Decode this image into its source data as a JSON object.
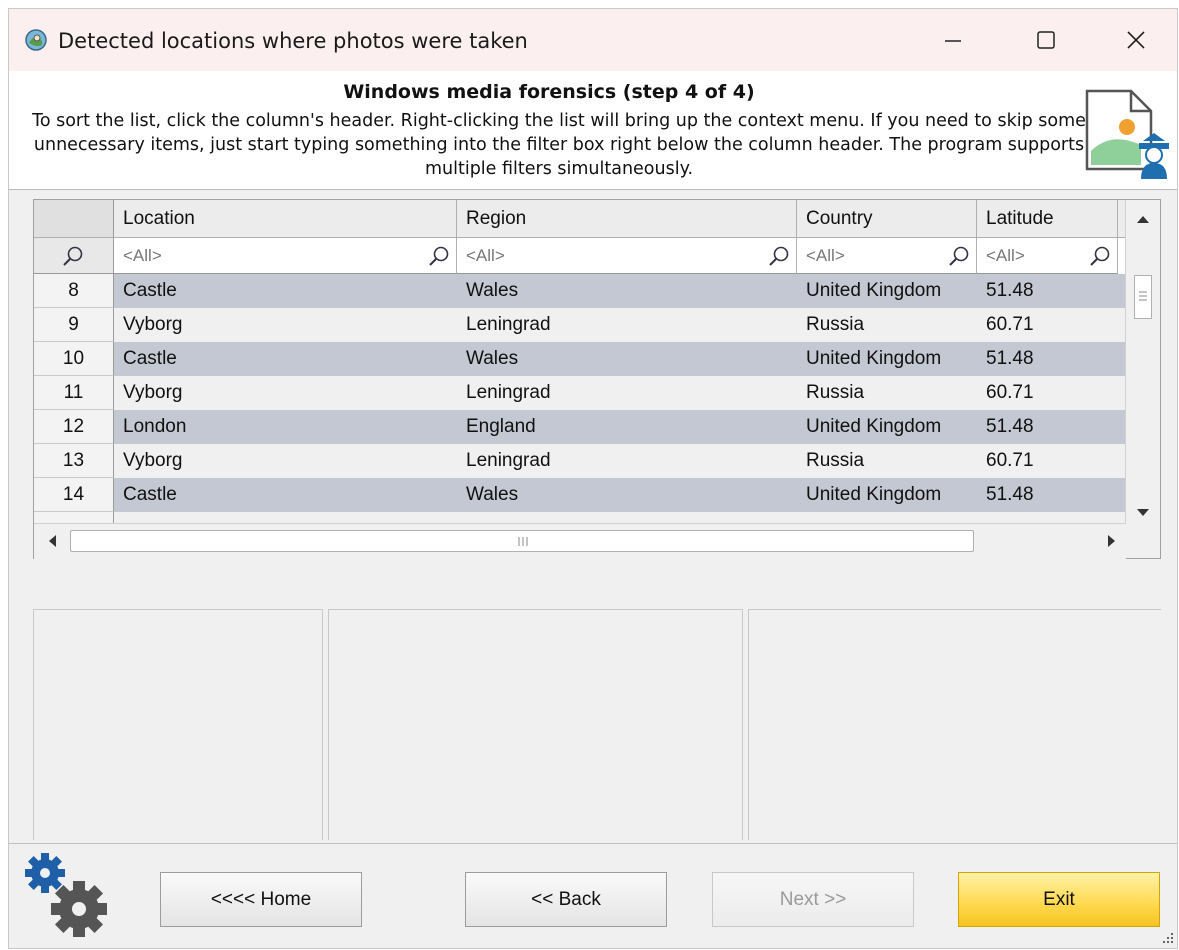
{
  "window": {
    "title": "Detected locations where photos were taken"
  },
  "header": {
    "title": "Windows media forensics (step 4 of 4)",
    "description": "To sort the list, click the column's header. Right-clicking the list will bring up the context menu. If you need to skip some unnecessary items, just start typing something into the filter box right below the column header. The program supports multiple filters simultaneously."
  },
  "grid": {
    "columns": [
      "Location",
      "Region",
      "Country",
      "Latitude"
    ],
    "filter_placeholder": "<All>",
    "rows": [
      {
        "num": "8",
        "location": "Castle",
        "region": "Wales",
        "country": "United Kingdom",
        "latitude": "51.48"
      },
      {
        "num": "9",
        "location": "Vyborg",
        "region": "Leningrad",
        "country": "Russia",
        "latitude": "60.71"
      },
      {
        "num": "10",
        "location": "Castle",
        "region": "Wales",
        "country": "United Kingdom",
        "latitude": "51.48"
      },
      {
        "num": "11",
        "location": "Vyborg",
        "region": "Leningrad",
        "country": "Russia",
        "latitude": "60.71"
      },
      {
        "num": "12",
        "location": "London",
        "region": "England",
        "country": "United Kingdom",
        "latitude": "51.48"
      },
      {
        "num": "13",
        "location": "Vyborg",
        "region": "Leningrad",
        "country": "Russia",
        "latitude": "60.71"
      },
      {
        "num": "14",
        "location": "Castle",
        "region": "Wales",
        "country": "United Kingdom",
        "latitude": "51.48"
      }
    ]
  },
  "buttons": {
    "home": "<<<< Home",
    "back": "<< Back",
    "next": "Next >>",
    "exit": "Exit"
  },
  "colors": {
    "titlebar": "#fcefef",
    "row_selected": "#c4c8d2",
    "row_normal": "#f0f0f0",
    "exit_button": "#ffd84d"
  }
}
